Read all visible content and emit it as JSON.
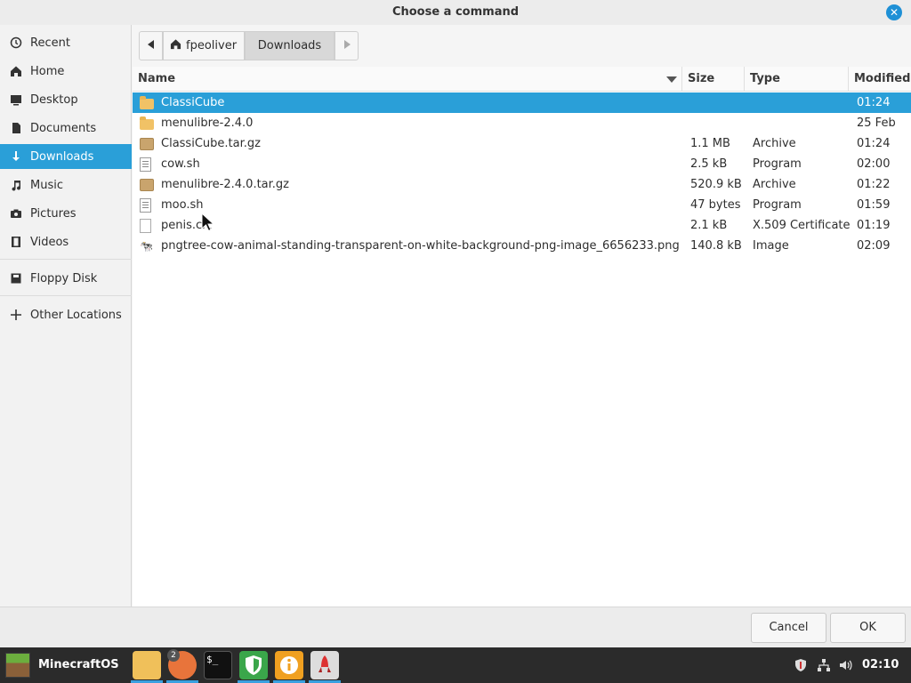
{
  "window": {
    "title": "Choose a command"
  },
  "sidebar": {
    "items": [
      {
        "label": "Recent",
        "icon": "clock-icon"
      },
      {
        "label": "Home",
        "icon": "home-icon"
      },
      {
        "label": "Desktop",
        "icon": "desktop-icon"
      },
      {
        "label": "Documents",
        "icon": "document-icon"
      },
      {
        "label": "Downloads",
        "icon": "download-icon",
        "active": true
      },
      {
        "label": "Music",
        "icon": "music-icon"
      },
      {
        "label": "Pictures",
        "icon": "camera-icon"
      },
      {
        "label": "Videos",
        "icon": "film-icon"
      },
      {
        "label": "Floppy Disk",
        "icon": "drive-icon"
      },
      {
        "label": "Other Locations",
        "icon": "plus-icon"
      }
    ]
  },
  "pathbar": {
    "home_label": "fpeoliver",
    "current_label": "Downloads"
  },
  "columns": {
    "name": "Name",
    "size": "Size",
    "type": "Type",
    "modified": "Modified"
  },
  "files": [
    {
      "name": "ClassiCube",
      "size": "",
      "type": "",
      "modified": "01:24",
      "icon": "folder-icon",
      "selected": true
    },
    {
      "name": "menulibre-2.4.0",
      "size": "",
      "type": "",
      "modified": "25 Feb",
      "icon": "folder-icon"
    },
    {
      "name": "ClassiCube.tar.gz",
      "size": "1.1 MB",
      "type": "Archive",
      "modified": "01:24",
      "icon": "archive-icon"
    },
    {
      "name": "cow.sh",
      "size": "2.5 kB",
      "type": "Program",
      "modified": "02:00",
      "icon": "text-file-icon"
    },
    {
      "name": "menulibre-2.4.0.tar.gz",
      "size": "520.9 kB",
      "type": "Archive",
      "modified": "01:22",
      "icon": "archive-icon"
    },
    {
      "name": "moo.sh",
      "size": "47 bytes",
      "type": "Program",
      "modified": "01:59",
      "icon": "text-file-icon"
    },
    {
      "name": "penis.crt",
      "size": "2.1 kB",
      "type": "X.509 Certificate",
      "modified": "01:19",
      "icon": "certificate-icon"
    },
    {
      "name": "pngtree-cow-animal-standing-transparent-on-white-background-png-image_6656233.png",
      "size": "140.8 kB",
      "type": "Image",
      "modified": "02:09",
      "icon": "image-file-icon"
    }
  ],
  "footer": {
    "cancel_label": "Cancel",
    "ok_label": "OK"
  },
  "taskbar": {
    "os_label": "MinecraftOS",
    "badge_count": "2",
    "clock": "02:10"
  },
  "colors": {
    "accent": "#2a9fd8",
    "taskbar": "#2b2b2b"
  }
}
